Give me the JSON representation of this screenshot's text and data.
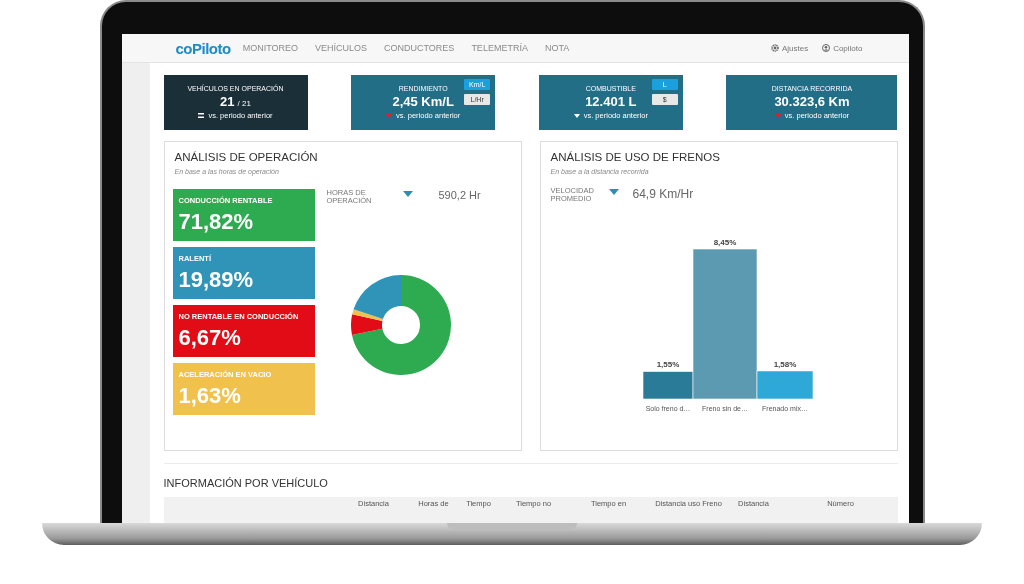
{
  "nav": {
    "logo": "coPiloto",
    "items": [
      "MONITOREO",
      "VEHÍCULOS",
      "CONDUCTORES",
      "TELEMETRÍA",
      "NOTA"
    ],
    "settings": "Ajustes",
    "user": "Copiloto"
  },
  "kpis": [
    {
      "kind": "dark",
      "title": "VEHÍCULOS EN OPERACIÓN",
      "value": "21",
      "suffix": "/ 21",
      "trend": {
        "kind": "equal",
        "color": "#ffffff"
      },
      "note": "vs. periodo anterior"
    },
    {
      "kind": "teal",
      "title": "RENDIMIENTO",
      "value": "2,45 Km/L",
      "trend": {
        "kind": "down",
        "color": "#e02020"
      },
      "note": "vs. periodo anterior",
      "toggles": [
        {
          "label": "Km/L",
          "selected": true
        },
        {
          "label": "L/Hr",
          "selected": false
        }
      ]
    },
    {
      "kind": "teal",
      "title": "COMBUSTIBLE",
      "value": "12.401 L",
      "trend": {
        "kind": "down",
        "color": "#ffffff"
      },
      "note": "vs. periodo anterior",
      "toggles": [
        {
          "label": "L",
          "selected": true
        },
        {
          "label": "$",
          "selected": false
        }
      ]
    },
    {
      "kind": "teal",
      "title": "DISTANCIA RECORRIDA",
      "value": "30.323,6 Km",
      "trend": {
        "kind": "down",
        "color": "#e02020"
      },
      "note": "vs. periodo anterior"
    }
  ],
  "operation": {
    "title": "ANÁLISIS DE OPERACIÓN",
    "subtitle": "En base a las horas de operación",
    "tiles": [
      {
        "label": "CONDUCCIÓN RENTABLE",
        "value": "71,82%",
        "color": "#2eaa50"
      },
      {
        "label": "RALENTÍ",
        "value": "19,89%",
        "color": "#2f94b8"
      },
      {
        "label": "NO RENTABLE EN CONDUCCIÓN",
        "value": "6,67%",
        "color": "#e20c17"
      },
      {
        "label": "ACELERACIÓN EN VACIO",
        "value": "1,63%",
        "color": "#f1c14d"
      }
    ],
    "metric": {
      "label": "HORAS DE OPERACIÓN",
      "value": "590,2 Hr"
    },
    "chart_data": {
      "type": "donut",
      "values": [
        71.82,
        6.67,
        1.63,
        19.89
      ],
      "colors": [
        "#2eaa50",
        "#e20c17",
        "#f1c14d",
        "#2f94b8"
      ]
    }
  },
  "brakes": {
    "title": "ANÁLISIS DE USO DE FRENOS",
    "subtitle": "En base a la distancia recorrida",
    "metric": {
      "label": "VELOCIDAD PROMEDIO",
      "value": "64,9 Km/Hr"
    },
    "chart_data": {
      "type": "bar",
      "categories": [
        "Solo freno d…",
        "Freno sin de…",
        "Frenado mix…"
      ],
      "series": [
        {
          "color": "#2a7b98",
          "values": [
            1.55,
            null,
            null
          ],
          "value_labels": [
            "1,55%",
            null,
            null
          ]
        },
        {
          "color": "#5b9ab0",
          "values": [
            null,
            8.45,
            null
          ],
          "value_labels": [
            null,
            "8,45%",
            null
          ]
        },
        {
          "color": "#2ea8d6",
          "values": [
            null,
            null,
            1.58
          ],
          "value_labels": [
            null,
            null,
            "1,58%"
          ]
        }
      ]
    }
  },
  "vehicles": {
    "title": "INFORMACIÓN POR VEHÍCULO",
    "columns": [
      "",
      "Distancia",
      "Horas de",
      "Tiempo",
      "Tiempo no",
      "Tiempo en",
      "Distancia uso Freno",
      "Distancia",
      "Número"
    ]
  }
}
